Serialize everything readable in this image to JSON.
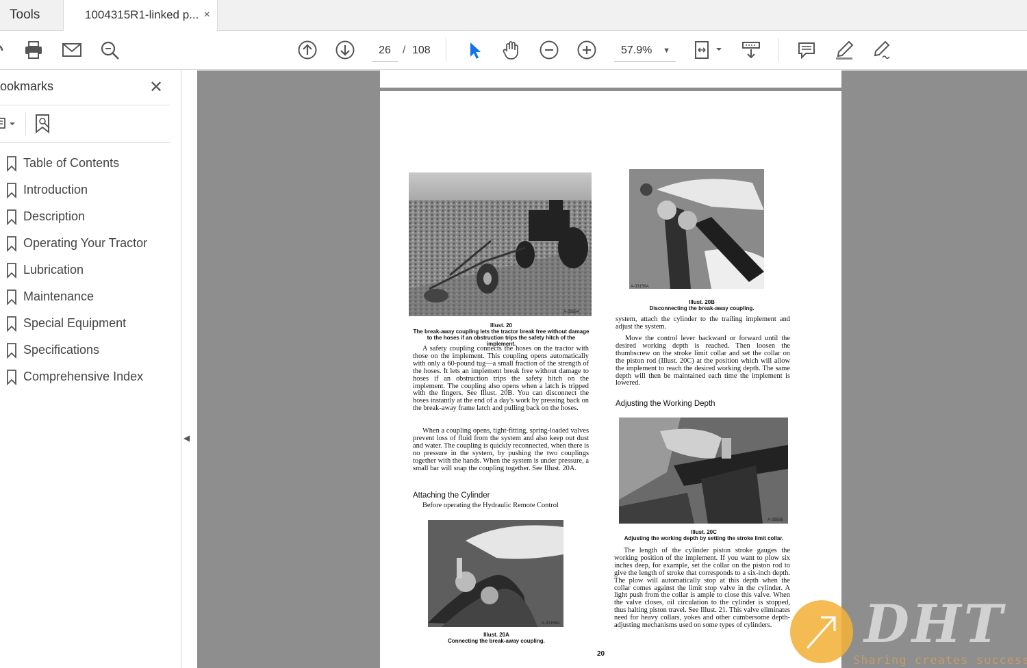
{
  "tabs": {
    "tools_label": "Tools",
    "document_label": "1004315R1-linked p...",
    "close_symbol": "×"
  },
  "toolbar": {
    "page_current": "26",
    "page_separator": "/",
    "page_total": "108",
    "zoom": "57.9%",
    "icons": [
      "share-icon",
      "print-icon",
      "email-icon",
      "search-zoom-icon",
      "prev-page-icon",
      "next-page-icon",
      "select-cursor-icon",
      "hand-icon",
      "zoom-out-icon",
      "zoom-in-icon",
      "page-fit-icon",
      "scroll-mode-icon",
      "comment-icon",
      "highlight-icon",
      "sign-icon"
    ],
    "accent": "#1473e6"
  },
  "sidebar": {
    "title": "ookmarks",
    "close_symbol": "✕",
    "bookmarks": [
      {
        "label": "Table of Contents"
      },
      {
        "label": "Introduction"
      },
      {
        "label": "Description"
      },
      {
        "label": "Operating Your Tractor"
      },
      {
        "label": "Lubrication"
      },
      {
        "label": "Maintenance"
      },
      {
        "label": "Special Equipment"
      },
      {
        "label": "Specifications"
      },
      {
        "label": "Comprehensive Index"
      }
    ]
  },
  "document": {
    "left_col": {
      "photo1_id": "A-29584",
      "caption1_title": "Illust. 20",
      "caption1_text": "The break-away coupling lets the tractor break free without damage to the hoses if an obstruction trips the safety hitch of the implement.",
      "para1": "A safety coupling connects the hoses on the tractor with those on the implement. This coupling opens automatically with only a 60-pound tug—a small fraction of the strength of the hoses. It lets an implement break free without damage to hoses if an obstruction trips the safety hitch on the implement. The coupling also opens when a latch is tripped with the fingers. See Illust. 20B. You can disconnect the hoses instantly at the end of a day's work by pressing back on the break-away frame latch and pulling back on the hoses.",
      "para2": "When a coupling opens, tight-fitting, spring-loaded valves prevent loss of fluid from the system and also keep out dust and water. The coupling is quickly reconnected, when there is no pressure in the system, by pushing the two couplings together with the hands. When the system is under pressure, a small bar will snap the coupling together. See Illust. 20A.",
      "heading": "Attaching the Cylinder",
      "para3": "Before operating the Hydraulic Remote Control",
      "photo2_id": "A-33155A",
      "caption2_title": "Illust. 20A",
      "caption2_text": "Connecting the break-away coupling."
    },
    "right_col": {
      "photo1_id": "A-33156A",
      "caption1_title": "Illust. 20B",
      "caption1_text": "Disconnecting the break-away coupling.",
      "para1": "system, attach the cylinder to the trailing implement and adjust the system.",
      "para2": "Move the control lever backward or forward until the desired working depth is reached. Then loosen the thumbscrew on the stroke limit collar and set the collar on the piston rod (Illust. 20C) at the position which will allow the implement to reach the desired working depth. The same depth will then be maintained each time the implement is lowered.",
      "heading": "Adjusting the Working Depth",
      "photo2_id": "A-29586",
      "caption2_title": "Illust. 20C",
      "caption2_text": "Adjusting the working depth by setting the stroke limit collar.",
      "para3": "The length of the cylinder piston stroke gauges the working position of the implement. If you want to plow six inches deep, for example, set the collar on the piston rod to give the length of stroke that corresponds to a six-inch depth. The plow will automatically stop at this depth when the collar comes against the limit stop valve in the cylinder. A light push from the collar is ample to close this valve. When the valve closes, oil circulation to the cylinder is stopped, thus halting piston travel. See Illust. 21. This valve eliminates need for heavy collars, yokes and other cumbersome depth-adjusting mechanisms used on some types of cylinders."
    },
    "page_number": "20"
  },
  "watermark": {
    "letters": "DHT",
    "tagline": "Sharing creates success",
    "color": "#f4b23c"
  }
}
